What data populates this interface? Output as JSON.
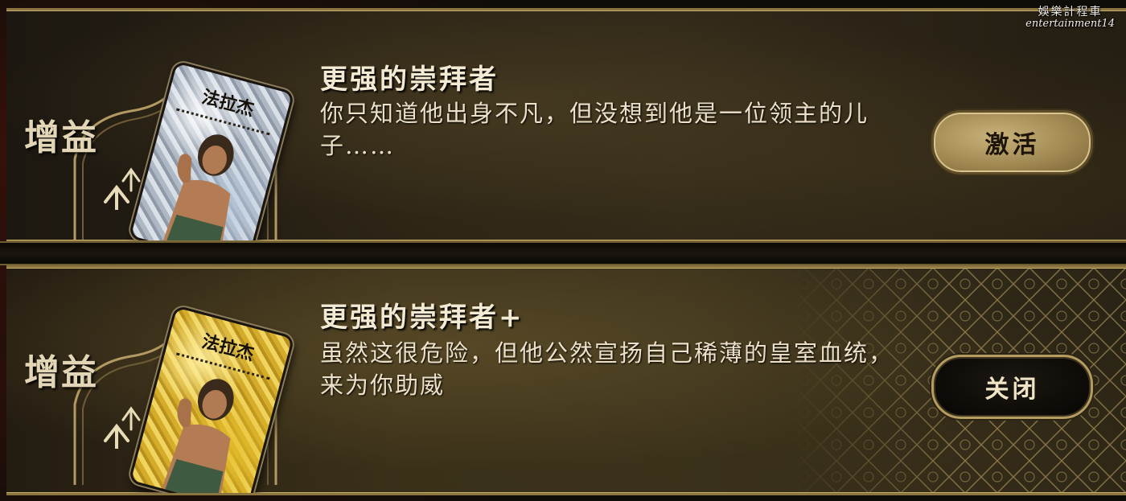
{
  "watermark": {
    "chinese": "娛樂計程車",
    "english": "entertainment14"
  },
  "buffs": [
    {
      "category_label": "增益",
      "card_name": "法拉杰",
      "card_style": "silver",
      "title": "更强的崇拜者",
      "description": "你只知道他出身不凡，但没想到他是一位领主的儿子……",
      "button_label": "激活"
    },
    {
      "category_label": "增益",
      "card_name": "法拉杰",
      "card_style": "gold",
      "title": "更强的崇拜者+",
      "description": "虽然这很危险，但他公然宣扬自己稀薄的皇室血统，来为你助威",
      "button_label": "关闭"
    }
  ],
  "icons": {
    "arrow": "double-up-arrow-icon",
    "portrait": "card-portrait-icon"
  },
  "colors": {
    "gold_trim": "#c9ae6c",
    "text_light": "#f3ead4",
    "button_gold": "#b59d60"
  }
}
